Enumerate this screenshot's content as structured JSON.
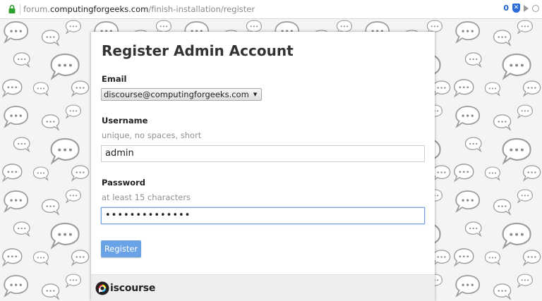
{
  "browser": {
    "url_prefix": "forum.",
    "url_host": "computingforgeeks.com",
    "url_path": "/finish-installation/register",
    "extension_count": "0"
  },
  "form": {
    "title": "Register Admin Account",
    "email_label": "Email",
    "email_value": "discourse@computingforgeeks.com",
    "username_label": "Username",
    "username_hint": "unique, no spaces, short",
    "username_value": "admin",
    "password_label": "Password",
    "password_hint": "at least 15 characters",
    "password_masked": "••••••••••••••",
    "register_label": "Register"
  },
  "footer": {
    "logo_text": "iscourse"
  },
  "colors": {
    "primary_button": "#6aa2e6",
    "focus_border": "#6da3e0",
    "logo_yellow": "#fff200",
    "logo_blue": "#00aeef",
    "logo_red": "#ed1c24"
  }
}
